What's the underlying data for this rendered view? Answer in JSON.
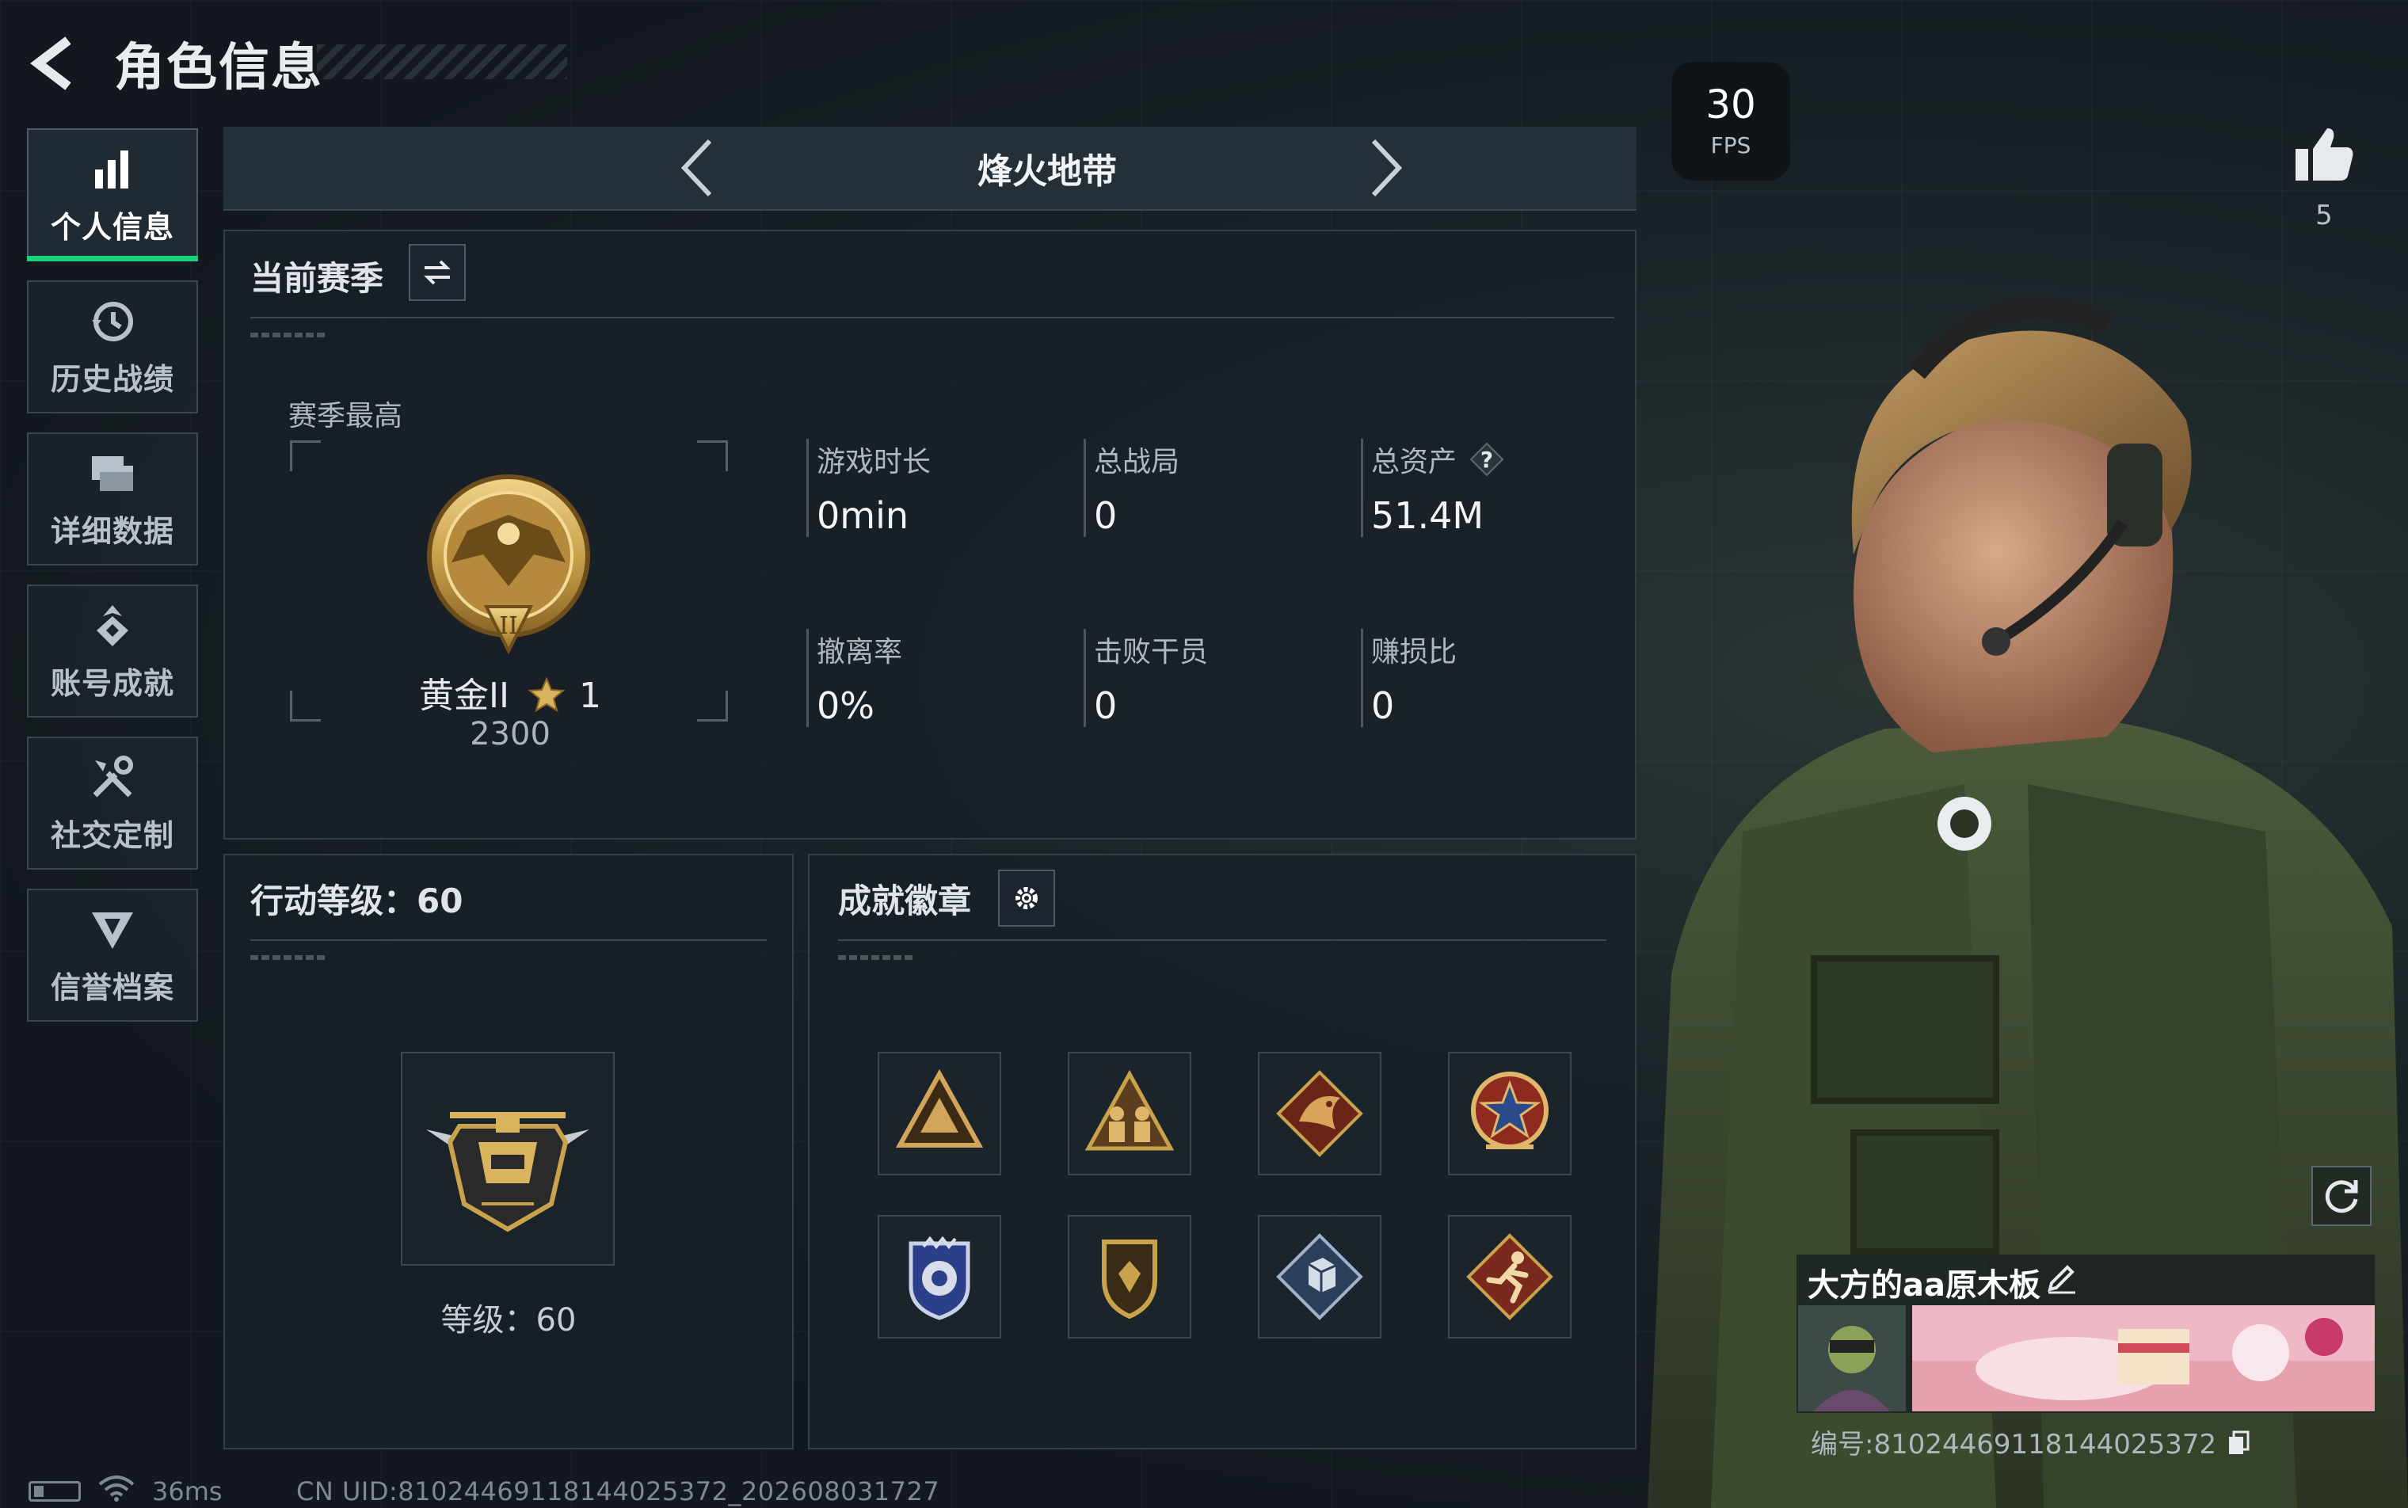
{
  "header": {
    "title": "角色信息"
  },
  "nav": {
    "items": [
      {
        "label": "个人信息",
        "icon": "bar-chart-icon",
        "active": true
      },
      {
        "label": "历史战绩",
        "icon": "history-icon",
        "active": false
      },
      {
        "label": "详细数据",
        "icon": "folder-icon",
        "active": false
      },
      {
        "label": "账号成就",
        "icon": "achievement-icon",
        "active": false
      },
      {
        "label": "社交定制",
        "icon": "tools-icon",
        "active": false
      },
      {
        "label": "信誉档案",
        "icon": "shield-icon",
        "active": false
      }
    ]
  },
  "mode": {
    "name": "烽火地带"
  },
  "season_panel": {
    "title": "当前赛季",
    "season_best_label": "赛季最高",
    "rank": {
      "name": "黄金II",
      "stars": "1",
      "score": "2300"
    },
    "stats": [
      {
        "label": "游戏时长",
        "value": "0min"
      },
      {
        "label": "总战局",
        "value": "0"
      },
      {
        "label": "总资产",
        "value": "51.4M",
        "help": "?"
      },
      {
        "label": "撤离率",
        "value": "0%"
      },
      {
        "label": "击败干员",
        "value": "0"
      },
      {
        "label": "赚损比",
        "value": "0"
      }
    ]
  },
  "level_panel": {
    "title": "行动等级：60",
    "level_text": "等级：60"
  },
  "badges_panel": {
    "title": "成就徽章",
    "badges": [
      "triangle-badge",
      "soldiers-badge",
      "dragon-badge",
      "star-emblem-badge",
      "police-badge",
      "shield-badge",
      "cube-badge",
      "runner-badge"
    ]
  },
  "overlay": {
    "fps_value": "30",
    "fps_label": "FPS",
    "likes": "5"
  },
  "player": {
    "name": "大方的aa原木板",
    "id": "编号:810244691181440253​72"
  },
  "status_bar": {
    "ping": "36ms",
    "uid": "CN UID:8102446911814402​5372_202608031727"
  },
  "colors": {
    "accent": "#18d37e",
    "gold": "#c9a24c",
    "panel": "#18202a"
  }
}
